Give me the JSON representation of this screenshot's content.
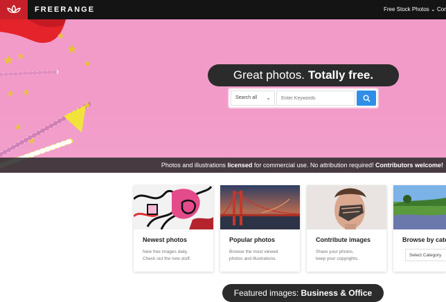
{
  "header": {
    "brand": "FREERANGE",
    "nav": [
      {
        "label": "Free Stock Photos ⌄"
      },
      {
        "label": "Con"
      }
    ]
  },
  "hero": {
    "title_regular": "Great photos.",
    "title_bold": "Totally free.",
    "search": {
      "scope": "Search all",
      "placeholder": "Enter Keywords"
    },
    "license": {
      "part1": "Photos and illustrations ",
      "bold1": "licensed",
      "part2": " for commercial use. No attribution required! ",
      "bold2": "Contributors welcome!"
    }
  },
  "cards": [
    {
      "title": "Newest photos",
      "desc1": "New free images daily.",
      "desc2": "Check out the new stuff."
    },
    {
      "title": "Popular photos",
      "desc1": "Browse the most viewed",
      "desc2": "photos and illustrations."
    },
    {
      "title": "Contribute images",
      "desc1": "Share your photos,",
      "desc2": "keep your copyrights."
    },
    {
      "title": "Browse by cate",
      "select": "Select Category"
    }
  ],
  "featured": {
    "regular": "Featured images:",
    "bold": "Business & Office"
  },
  "colors": {
    "topbar": "#141414",
    "logo_red": "#c8202a",
    "hero_pink": "#f29bc9",
    "search_blue": "#2f8fe6"
  }
}
